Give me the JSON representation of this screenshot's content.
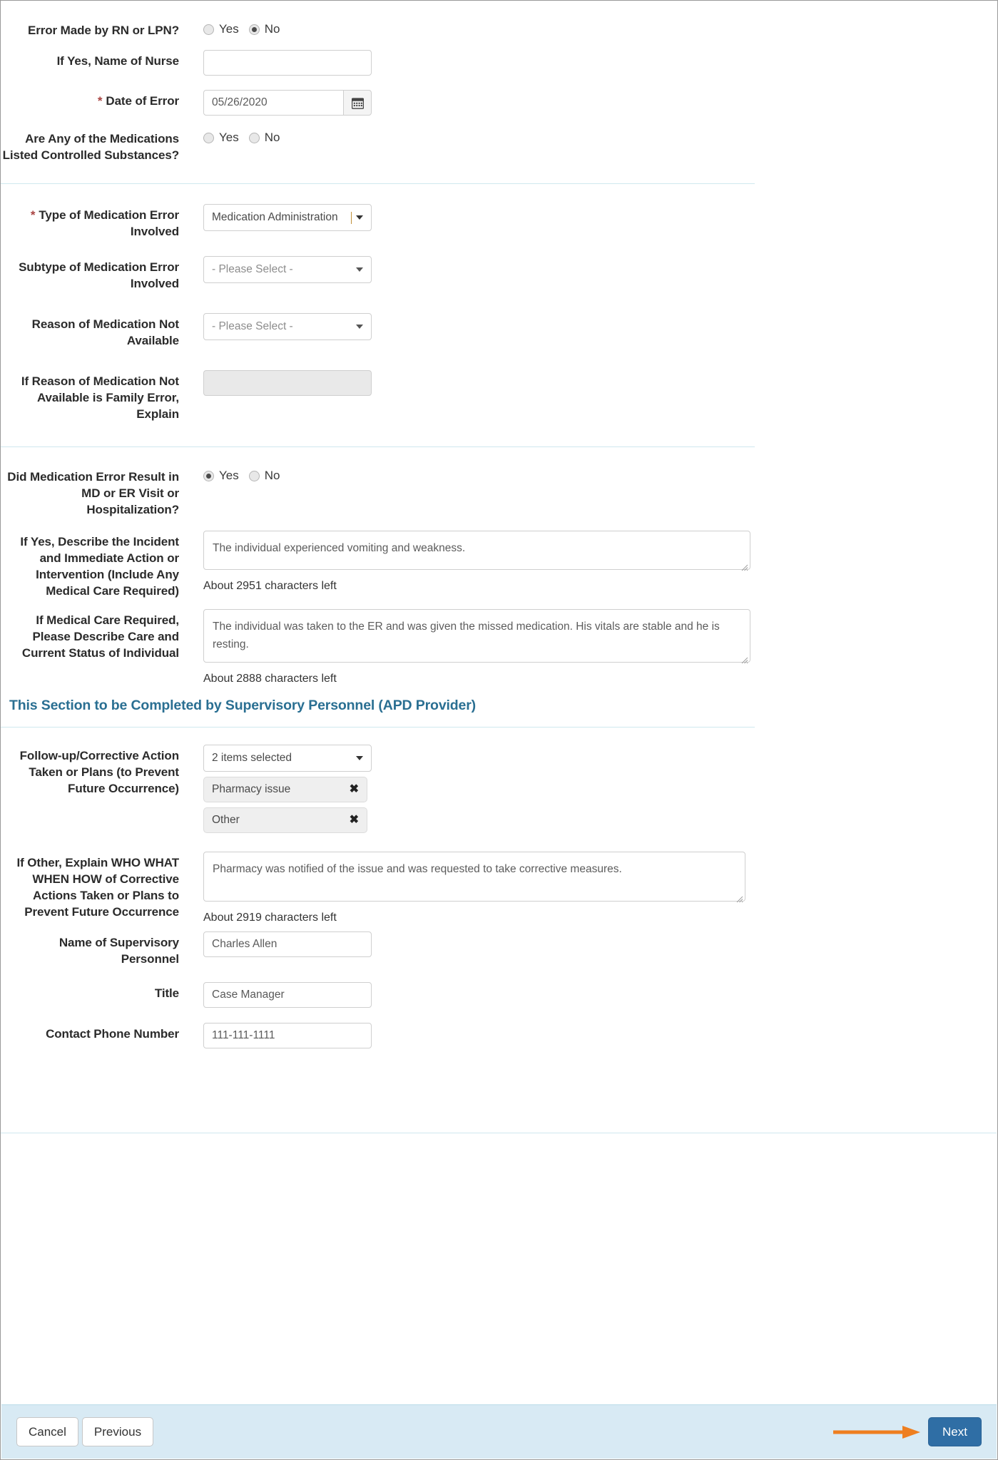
{
  "form": {
    "sections": [
      {
        "id": "error-details",
        "rows": [
          {
            "id": "error-made-by-rn",
            "label": "Error Made by RN or LPN?",
            "required": false,
            "type": "radio",
            "options": [
              "Yes",
              "No"
            ],
            "selected": "No"
          },
          {
            "id": "name-of-nurse",
            "label": "If Yes, Name of Nurse",
            "required": false,
            "type": "text",
            "value": "",
            "placeholder": ""
          },
          {
            "id": "date-of-error",
            "label": "Date of Error",
            "required": true,
            "type": "date",
            "value": "05/26/2020",
            "icon": "calendar-icon"
          },
          {
            "id": "controlled-substances",
            "label": "Are Any of the Medications Listed Controlled Substances?",
            "required": false,
            "type": "radio",
            "options": [
              "Yes",
              "No"
            ],
            "selected": ""
          }
        ]
      },
      {
        "id": "medication-error-type",
        "rows": [
          {
            "id": "type-of-medication-error",
            "label": "Type of Medication Error Involved",
            "required": true,
            "type": "select",
            "value": "Medication Administration"
          },
          {
            "id": "subtype-of-medication-error",
            "label": "Subtype of Medication Error Involved",
            "required": false,
            "type": "select",
            "value": "- Please Select -"
          },
          {
            "id": "reason-medication-not-available",
            "label": "Reason of Medication Not Available",
            "required": false,
            "type": "select",
            "value": "- Please Select -"
          },
          {
            "id": "family-error-explain",
            "label": "If Reason of Medication Not Available is Family Error, Explain",
            "required": false,
            "type": "text-disabled",
            "value": ""
          }
        ]
      },
      {
        "id": "md-er-visit",
        "rows": [
          {
            "id": "md-er-visit-result",
            "label": "Did Medication Error Result in MD or ER Visit or Hospitalization?",
            "required": false,
            "type": "radio",
            "options": [
              "Yes",
              "No"
            ],
            "selected": "Yes"
          },
          {
            "id": "describe-incident",
            "label": "If Yes, Describe the Incident and Immediate Action or Intervention (Include Any Medical Care Required)",
            "required": false,
            "type": "textarea",
            "value": "The individual experienced vomiting and weakness.",
            "counter": "About 2951 characters left"
          },
          {
            "id": "describe-care-status",
            "label": "If Medical Care Required, Please Describe Care and Current Status of Individual",
            "required": false,
            "type": "textarea",
            "value": "The individual was taken to the ER and was given the missed medication. His vitals are stable and he is resting.",
            "counter": "About 2888 characters left"
          }
        ]
      }
    ],
    "supervisory_section": {
      "title": "This Section to be Completed by Supervisory Personnel (APD Provider)",
      "rows": [
        {
          "id": "followup-corrective-action",
          "label": "Follow-up/Corrective Action Taken or Plans (to Prevent Future Occurrence)",
          "required": false,
          "type": "multiselect",
          "value": "2 items selected",
          "chips": [
            "Pharmacy issue",
            "Other"
          ]
        },
        {
          "id": "if-other-explain",
          "label": "If Other, Explain WHO WHAT WHEN HOW of Corrective Actions Taken or Plans to Prevent Future Occurrence",
          "required": false,
          "type": "textarea",
          "value": "Pharmacy was notified of the issue and was requested to take corrective measures.",
          "counter": "About 2919 characters left"
        },
        {
          "id": "name-supervisory-personnel",
          "label": "Name of Supervisory Personnel",
          "required": false,
          "type": "text",
          "value": "Charles Allen"
        },
        {
          "id": "title",
          "label": "Title",
          "required": false,
          "type": "text",
          "value": "Case Manager"
        },
        {
          "id": "contact-phone-number",
          "label": "Contact Phone Number",
          "required": false,
          "type": "text",
          "value": "111-111-1111"
        }
      ]
    }
  },
  "footer": {
    "cancel_label": "Cancel",
    "previous_label": "Previous",
    "next_label": "Next",
    "annotation_icon": "orange-arrow-right-icon"
  },
  "colors": {
    "primary_button": "#2f6ea5",
    "footer_background": "#d8eaf4",
    "divider": "#cfe8ee",
    "section_title": "#2a6f92",
    "required_asterisk": "#a94442",
    "annotation_arrow": "#ee7f20"
  }
}
